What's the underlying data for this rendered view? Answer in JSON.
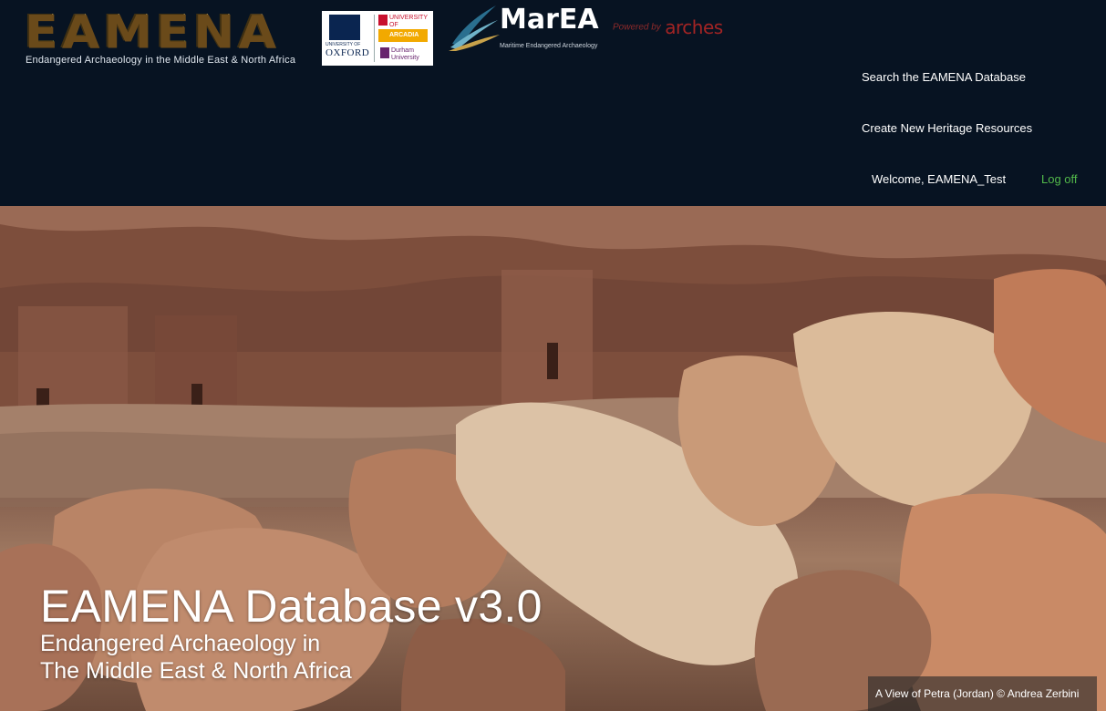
{
  "header": {
    "eamena_logo_text": "EAMENA",
    "eamena_tagline": "Endangered Archaeology in the Middle East & North Africa",
    "universities": {
      "oxford_small": "UNIVERSITY OF",
      "oxford": "OXFORD",
      "leicester": "UNIVERSITY OF LEICESTER",
      "arcadia": "ARCADIA",
      "durham": "Durham University"
    },
    "marea_title": "MarEA",
    "marea_subtitle": "Maritime Endangered Archaeology",
    "powered_by": "Powered by",
    "arches": "arches"
  },
  "nav": {
    "search": "Search the EAMENA Database",
    "create": "Create New Heritage Resources",
    "welcome": "Welcome, EAMENA_Test",
    "logoff": "Log off"
  },
  "hero": {
    "title": "EAMENA Database v3.0",
    "subtitle_line1": "Endangered Archaeology in",
    "subtitle_line2": "The Middle East & North Africa",
    "credit": "A View of Petra (Jordan) © Andrea Zerbini"
  },
  "colors": {
    "header_bg": "#071322",
    "logoff_link": "#52b84a",
    "arches_brand": "#a32424"
  }
}
